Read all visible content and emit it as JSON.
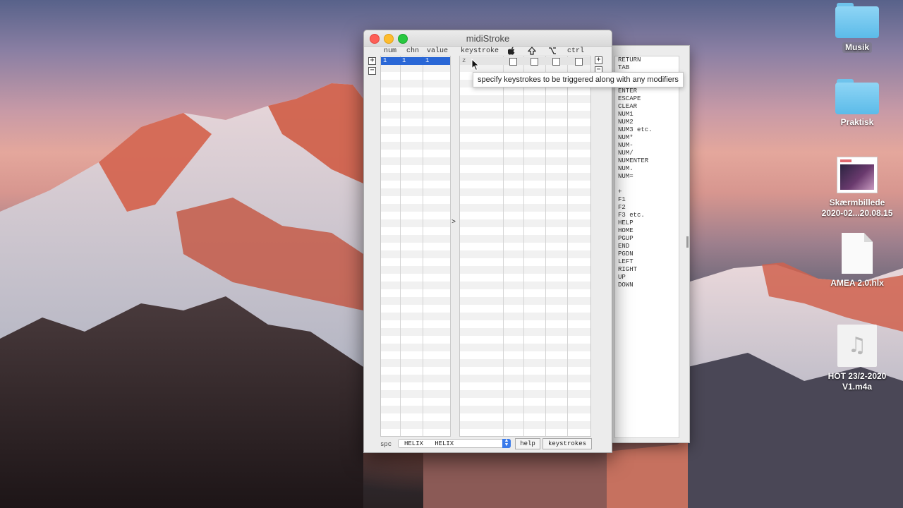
{
  "desktop": {
    "items": [
      {
        "label": "Musik"
      },
      {
        "label": "Praktisk"
      },
      {
        "label": "Skærmbillede",
        "label2": "2020-02...20.08.15"
      },
      {
        "label": "AMEA 2.0.hlx"
      },
      {
        "label": "HOT 23/2-2020",
        "label2": "V1.m4a"
      }
    ]
  },
  "keys_window": {
    "keys": [
      "RETURN",
      "TAB",
      "",
      "",
      "ENTER",
      "ESCAPE",
      "CLEAR",
      "NUM1",
      "NUM2",
      "NUM3 etc.",
      "NUM*",
      "NUM-",
      "NUM/",
      "NUMENTER",
      "NUM.",
      "NUM=",
      "",
      "+",
      "F1",
      "F2",
      "F3 etc.",
      "HELP",
      "HOME",
      "PGUP",
      "END",
      "PGDN",
      "LEFT",
      "RIGHT",
      "UP",
      "DOWN"
    ]
  },
  "window": {
    "title": "midiStroke",
    "columns": {
      "num": "num",
      "chn": "chn",
      "value": "value",
      "keystroke": "keystroke",
      "ctrl": "ctrl"
    },
    "modifier_icons": [
      "apple-icon",
      "shift-icon",
      "option-icon"
    ],
    "add_label": "+",
    "remove_label": "−",
    "row1": {
      "num": "1",
      "chn": "1",
      "value": "1",
      "keystroke": "z"
    },
    "middle_arrow": ">",
    "bottom": {
      "spc_label": "spc",
      "device_value": "HELIX   HELIX",
      "help_label": "help",
      "keystrokes_label": "keystrokes"
    }
  },
  "tooltip": {
    "text": "specify keystrokes to be triggered along with any modifiers"
  }
}
